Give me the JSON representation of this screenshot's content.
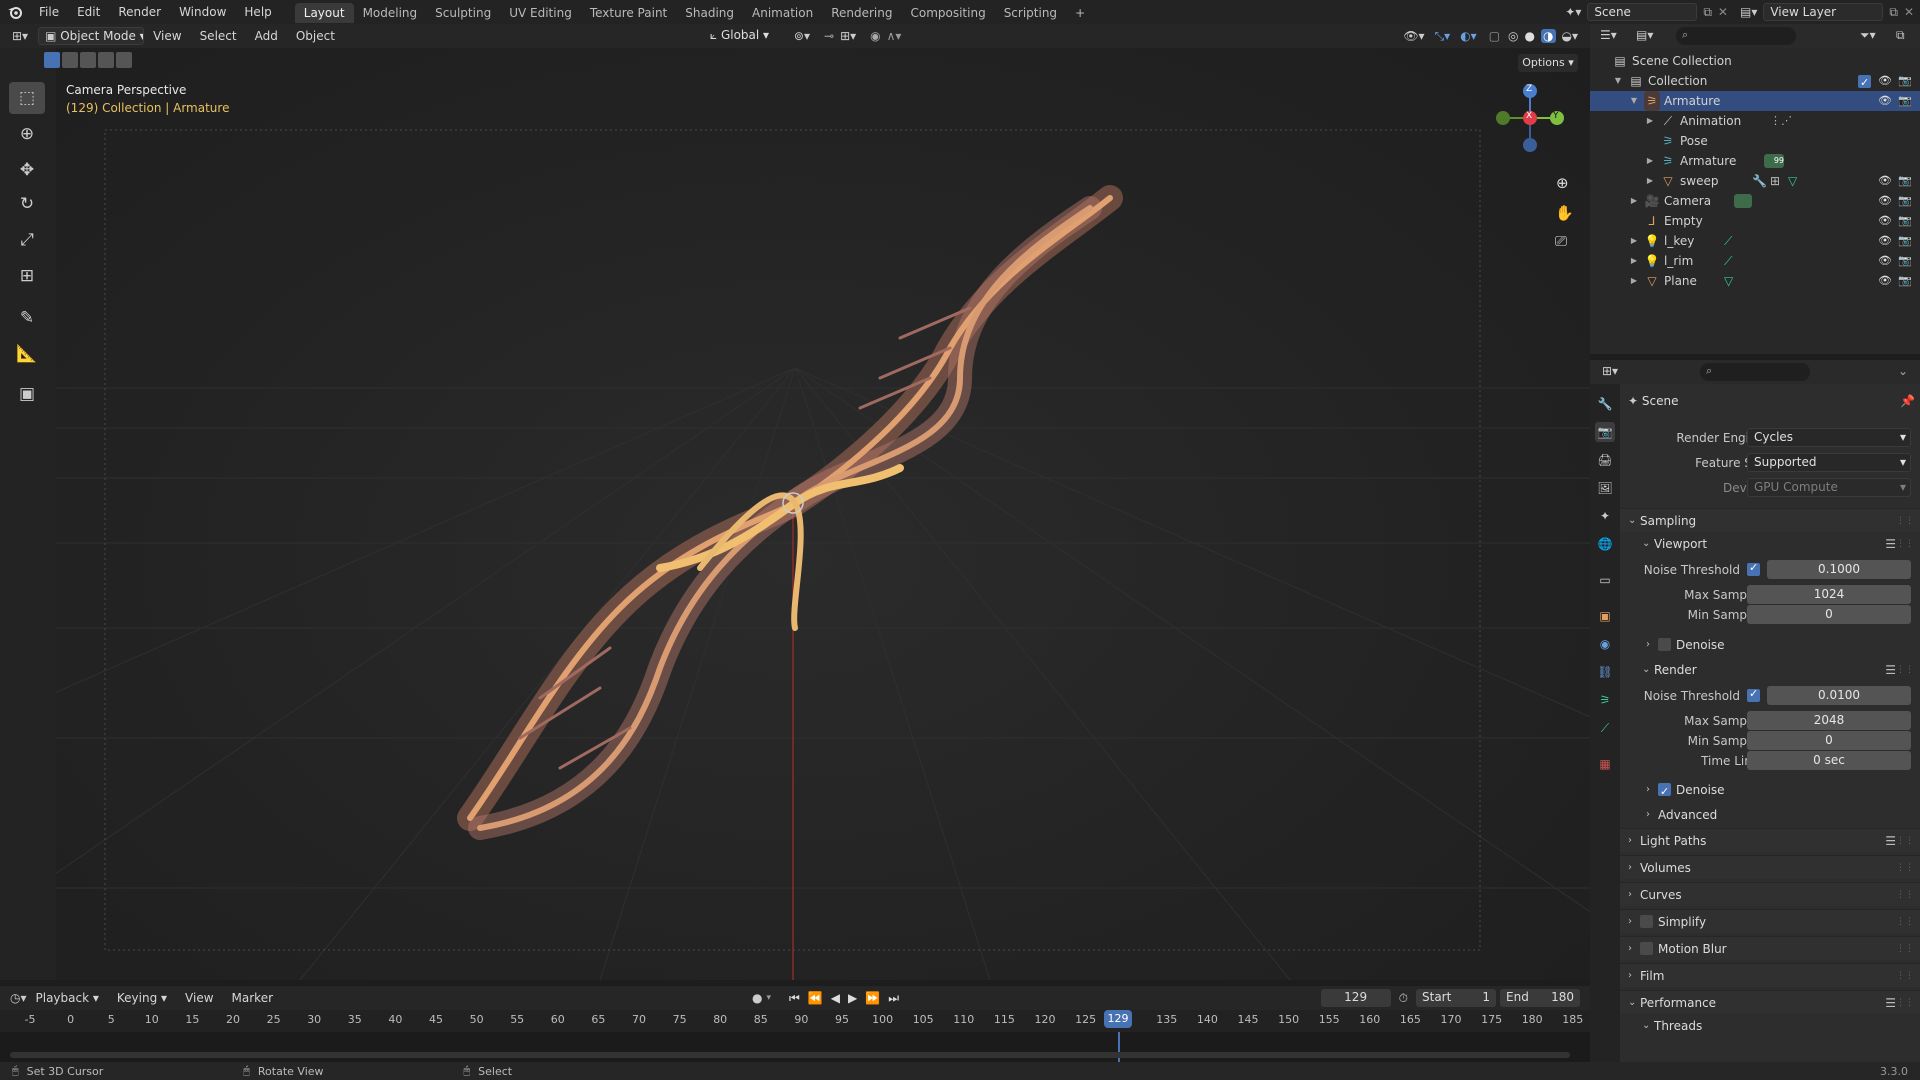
{
  "app": {
    "logo": "blender-logo-icon"
  },
  "menu": [
    "File",
    "Edit",
    "Render",
    "Window",
    "Help"
  ],
  "workspaces": [
    "Layout",
    "Modeling",
    "Sculpting",
    "UV Editing",
    "Texture Paint",
    "Shading",
    "Animation",
    "Rendering",
    "Compositing",
    "Scripting"
  ],
  "workspace_add": "+",
  "scene_name": "Scene",
  "view_layer": "View Layer",
  "viewport_header": {
    "mode": "Object Mode",
    "menus": [
      "View",
      "Select",
      "Add",
      "Object"
    ],
    "orientation": "Global",
    "options": "Options"
  },
  "viewport": {
    "title": "Camera Perspective",
    "subtitle": "(129) Collection | Armature",
    "gizmo": {
      "x": "X",
      "y": "Y",
      "z": "Z"
    }
  },
  "outliner": {
    "rows": [
      {
        "label": "Scene Collection",
        "icon": "scene-collection-icon"
      },
      {
        "label": "Collection",
        "icon": "collection-icon"
      },
      {
        "label": "Armature",
        "icon": "armature-icon"
      },
      {
        "label": "Animation",
        "icon": "animation-icon"
      },
      {
        "label": "Pose",
        "icon": "pose-icon"
      },
      {
        "label": "Armature",
        "icon": "armature-data-icon"
      },
      {
        "label": "sweep",
        "icon": "mesh-icon"
      },
      {
        "label": "Camera",
        "icon": "camera-icon"
      },
      {
        "label": "Empty",
        "icon": "empty-icon"
      },
      {
        "label": "l_key",
        "icon": "light-icon"
      },
      {
        "label": "l_rim",
        "icon": "light-icon"
      },
      {
        "label": "Plane",
        "icon": "mesh-icon"
      }
    ],
    "badge_count": "99"
  },
  "properties": {
    "context": "Scene",
    "render_engine_label": "Render Engine",
    "render_engine": "Cycles",
    "feature_set_label": "Feature Set",
    "feature_set": "Supported",
    "device_label": "Device",
    "device": "GPU Compute",
    "sampling": "Sampling",
    "viewport": "Viewport",
    "render": "Render",
    "noise_threshold_label": "Noise Threshold",
    "max_samples_label": "Max Samples",
    "min_samples_label": "Min Samples",
    "time_limit_label": "Time Limit",
    "denoise_label": "Denoise",
    "advanced_label": "Advanced",
    "viewport_noise_threshold": "0.1000",
    "viewport_max_samples": "1024",
    "viewport_min_samples": "0",
    "render_noise_threshold": "0.0100",
    "render_max_samples": "2048",
    "render_min_samples": "0",
    "render_time_limit": "0 sec",
    "sections": [
      "Light Paths",
      "Volumes",
      "Curves",
      "Simplify",
      "Motion Blur",
      "Film",
      "Performance"
    ],
    "threads": "Threads"
  },
  "timeline": {
    "menus": [
      "Playback",
      "Keying",
      "View",
      "Marker"
    ],
    "current_frame": "129",
    "start_label": "Start",
    "start": "1",
    "end_label": "End",
    "end": "180",
    "ticks": [
      "-5",
      "0",
      "5",
      "10",
      "15",
      "20",
      "25",
      "30",
      "35",
      "40",
      "45",
      "50",
      "55",
      "60",
      "65",
      "70",
      "75",
      "80",
      "85",
      "90",
      "95",
      "100",
      "105",
      "110",
      "115",
      "120",
      "125",
      "129",
      "135",
      "140",
      "145",
      "150",
      "155",
      "160",
      "165",
      "170",
      "175",
      "180",
      "185"
    ]
  },
  "status": {
    "left": "Set 3D Cursor",
    "mid": "Rotate View",
    "right": "Select",
    "version": "3.3.0"
  }
}
